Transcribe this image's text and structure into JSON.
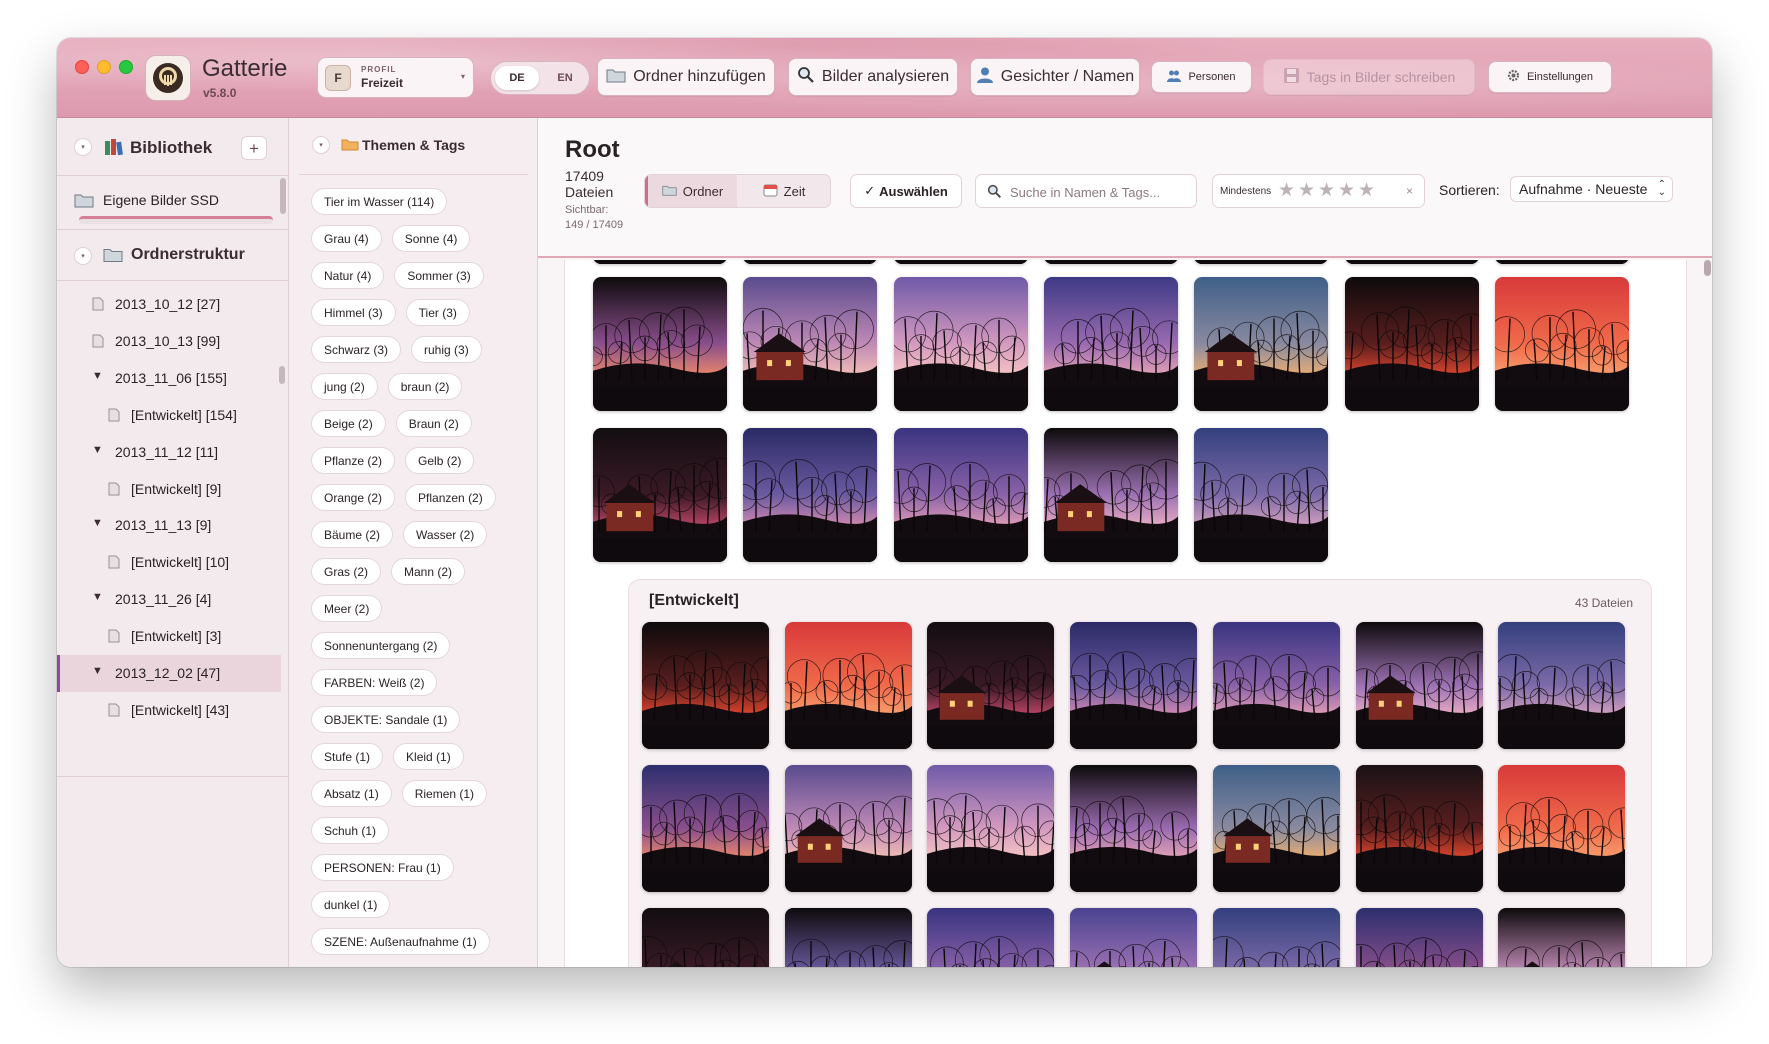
{
  "app": {
    "name": "Gatterie",
    "version": "v5.8.0",
    "profile": {
      "label": "PROFIL",
      "initial": "F",
      "name": "Freizeit"
    },
    "languages": [
      "DE",
      "EN"
    ],
    "active_language": "DE"
  },
  "toolbar": {
    "add_folder": "Ordner hinzufügen",
    "analyze": "Bilder analysieren",
    "faces": "Gesichter / Namen",
    "persons": "Personen",
    "write_tags": "Tags in Bilder schreiben",
    "settings": "Einstellungen"
  },
  "library": {
    "title": "Bibliothek",
    "add_label": "+",
    "items": [
      {
        "label": "Eigene Bilder SSD"
      }
    ]
  },
  "tree": {
    "title": "Ordnerstruktur",
    "rows": [
      {
        "label": "2013_10_12 [27]",
        "level": 0,
        "expanded": false,
        "selected": false
      },
      {
        "label": "2013_10_13 [99]",
        "level": 0,
        "expanded": false,
        "selected": false
      },
      {
        "label": "2013_11_06 [155]",
        "level": 0,
        "expanded": true,
        "selected": false
      },
      {
        "label": "[Entwickelt] [154]",
        "level": 1,
        "expanded": false,
        "selected": false
      },
      {
        "label": "2013_11_12 [11]",
        "level": 0,
        "expanded": true,
        "selected": false
      },
      {
        "label": "[Entwickelt] [9]",
        "level": 1,
        "expanded": false,
        "selected": false
      },
      {
        "label": "2013_11_13 [9]",
        "level": 0,
        "expanded": true,
        "selected": false
      },
      {
        "label": "[Entwickelt] [10]",
        "level": 1,
        "expanded": false,
        "selected": false
      },
      {
        "label": "2013_11_26 [4]",
        "level": 0,
        "expanded": true,
        "selected": false
      },
      {
        "label": "[Entwickelt] [3]",
        "level": 1,
        "expanded": false,
        "selected": false
      },
      {
        "label": "2013_12_02 [47]",
        "level": 0,
        "expanded": true,
        "selected": true
      },
      {
        "label": "[Entwickelt] [43]",
        "level": 1,
        "expanded": false,
        "selected": false
      }
    ]
  },
  "tags": {
    "title": "Themen & Tags",
    "items": [
      "Tier im Wasser (114)",
      "Grau (4)",
      "Sonne (4)",
      "Natur (4)",
      "Sommer (3)",
      "Himmel (3)",
      "Tier (3)",
      "Schwarz (3)",
      "ruhig (3)",
      "jung (2)",
      "braun (2)",
      "Beige (2)",
      "Braun (2)",
      "Pflanze (2)",
      "Gelb (2)",
      "Orange (2)",
      "Pflanzen (2)",
      "Bäume (2)",
      "Wasser (2)",
      "Gras (2)",
      "Mann (2)",
      "Meer (2)",
      "Sonnenuntergang (2)",
      "FARBEN: Weiß (2)",
      "OBJEKTE: Sandale (1)",
      "Stufe (1)",
      "Kleid (1)",
      "Absatz (1)",
      "Riemen (1)",
      "Schuh (1)",
      "PERSONEN: Frau (1)",
      "dunkel (1)",
      "SZENE: Außenaufnahme (1)"
    ]
  },
  "main": {
    "title": "Root",
    "count": "17409 Dateien",
    "visible": "Sichtbar: 149 / 17409",
    "view_modes": [
      "Ordner",
      "Zeit"
    ],
    "active_view": "Ordner",
    "select_label": "Auswählen",
    "search_placeholder": "Suche in Namen & Tags...",
    "rating_label": "Mindestens",
    "rating_value": 0,
    "rating_clear": "×",
    "sort_label": "Sortieren:",
    "sort_value": "Aufnahme · Neueste",
    "subfolder": {
      "title": "[Entwickelt]",
      "count": "43 Dateien"
    }
  },
  "thumbnails": {
    "root": [
      "t1",
      "t2",
      "t3",
      "t4",
      "t5",
      "t6",
      "t7",
      "t8",
      "t9",
      "t10",
      "t11",
      "t12"
    ],
    "sub": [
      "s1",
      "s2",
      "s3",
      "s4",
      "s5",
      "s6",
      "s7",
      "s8",
      "s9",
      "s10",
      "s11",
      "s12",
      "s13",
      "s14",
      "s15",
      "s16",
      "s17",
      "s18",
      "s19",
      "s20",
      "s21"
    ]
  },
  "colors": {
    "toolbar": "#e0a3b5",
    "accent": "#d26b89",
    "selection": "#ead5dc",
    "selection_bar": "#8a4c9a"
  }
}
